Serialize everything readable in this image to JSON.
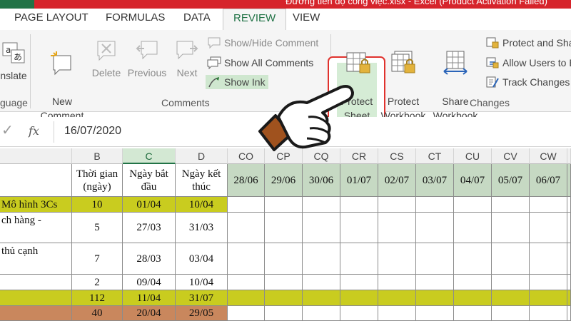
{
  "title_bar": {
    "text": "Đường tiến độ công việc.xlsx - Excel (Product Activation Failed)"
  },
  "tabs": [
    {
      "label": "PAGE LAYOUT",
      "active": false
    },
    {
      "label": "FORMULAS",
      "active": false
    },
    {
      "label": "DATA",
      "active": false
    },
    {
      "label": "REVIEW",
      "active": true
    },
    {
      "label": "VIEW",
      "active": false
    }
  ],
  "ribbon": {
    "language": {
      "translate_label": "nslate",
      "group_label": "guage"
    },
    "comments": {
      "new_comment": "New\nComment",
      "delete": "Delete",
      "previous": "Previous",
      "next": "Next",
      "show_hide": "Show/Hide Comment",
      "show_all": "Show All Comments",
      "show_ink": "Show Ink",
      "group_label": "Comments"
    },
    "changes": {
      "protect_sheet": "Protect\nSheet",
      "protect_workbook": "Protect\nWorkbook",
      "share_workbook": "Share\nWorkbook",
      "protect_and_share": "Protect and Sha",
      "allow_users": "Allow Users to E",
      "track_changes": "Track Changes",
      "group_label": "Changes"
    }
  },
  "formula_bar": {
    "fx": "fx",
    "value": "16/07/2020"
  },
  "columns": {
    "fixed": [
      "B",
      "C",
      "D"
    ],
    "dates": [
      "CO",
      "CP",
      "CQ",
      "CR",
      "CS",
      "CT",
      "CU",
      "CV",
      "CW"
    ]
  },
  "headers": {
    "b": "Thời gian (ngày)",
    "c": "Ngày bắt đầu",
    "d": "Ngày kết thúc",
    "dates": [
      "28/06",
      "29/06",
      "30/06",
      "01/07",
      "02/07",
      "03/07",
      "04/07",
      "05/07",
      "06/07"
    ]
  },
  "rows": [
    {
      "a": "Mô hình 3Cs",
      "b": "10",
      "c": "01/04",
      "d": "10/04"
    },
    {
      "a": "ch hàng -",
      "b": "5",
      "c": "27/03",
      "d": "31/03"
    },
    {
      "a": "thủ cạnh",
      "b": "7",
      "c": "28/03",
      "d": "03/04"
    },
    {
      "a": "",
      "b": "2",
      "c": "09/04",
      "d": "10/04"
    },
    {
      "a": "",
      "b": "112",
      "c": "11/04",
      "d": "31/07"
    },
    {
      "a": "",
      "b": "40",
      "c": "20/04",
      "d": "29/05"
    }
  ]
}
